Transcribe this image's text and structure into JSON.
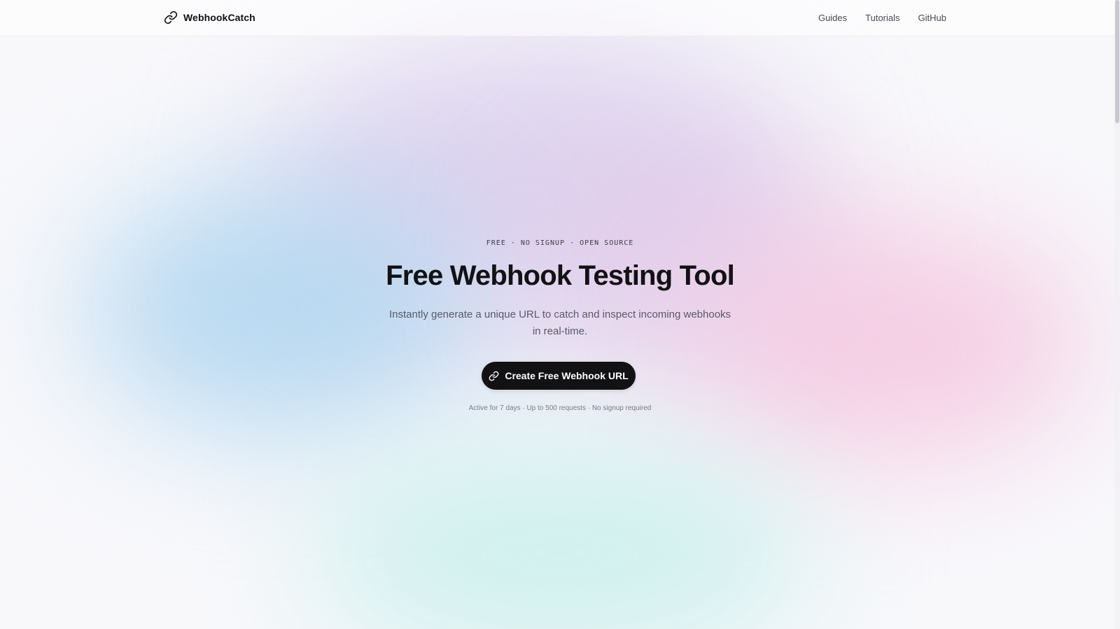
{
  "header": {
    "brand_name": "WebhookCatch",
    "nav": [
      {
        "label": "Guides"
      },
      {
        "label": "Tutorials"
      },
      {
        "label": "GitHub"
      }
    ]
  },
  "hero": {
    "eyebrow": "FREE · NO SIGNUP · OPEN SOURCE",
    "title": "Free Webhook Testing Tool",
    "subtitle": "Instantly generate a unique URL to catch and inspect incoming webhooks in real-time.",
    "cta_label": "Create Free Webhook URL",
    "fineprint": "Active for 7 days · Up to 500 requests · No signup required"
  },
  "icons": {
    "brand": "link-icon",
    "cta": "link-icon"
  },
  "colors": {
    "primary_button": "#121214",
    "text_dark": "#121214",
    "text_muted": "#5a5a66"
  }
}
